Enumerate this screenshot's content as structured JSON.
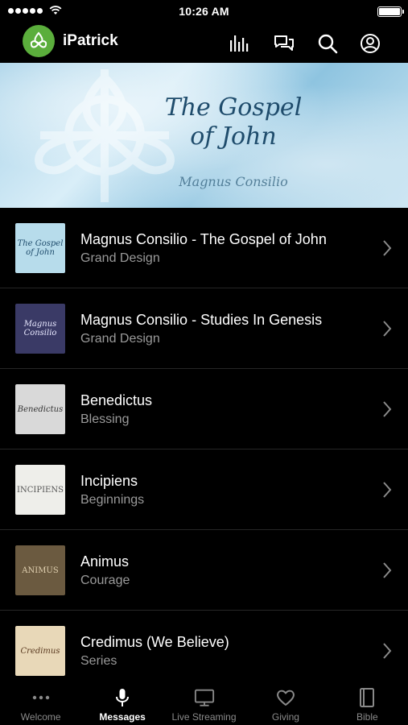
{
  "status_bar": {
    "time": "10:26 AM",
    "battery_level": 1.0
  },
  "header": {
    "app_title": "iPatrick",
    "icons": [
      "audio-bars-icon",
      "chat-bubbles-icon",
      "search-icon",
      "profile-icon"
    ]
  },
  "banner": {
    "title_line1": "The Gospel",
    "title_line2": "of John",
    "subtitle": "Magnus Consilio"
  },
  "list": {
    "items": [
      {
        "title": "Magnus Consilio - The Gospel of John",
        "subtitle": "Grand Design",
        "thumb_text": "The Gospel of John",
        "thumb_color": "#b7dceb"
      },
      {
        "title": "Magnus Consilio - Studies In Genesis",
        "subtitle": "Grand Design",
        "thumb_text": "Magnus Consilio",
        "thumb_color": "#3a3a66"
      },
      {
        "title": "Benedictus",
        "subtitle": "Blessing",
        "thumb_text": "Benedictus",
        "thumb_color": "#d9d9d9"
      },
      {
        "title": "Incipiens",
        "subtitle": "Beginnings",
        "thumb_text": "INCIPIENS",
        "thumb_color": "#eeeeea"
      },
      {
        "title": "Animus",
        "subtitle": "Courage",
        "thumb_text": "ANIMUS",
        "thumb_color": "#6b5a40"
      },
      {
        "title": "Credimus (We Believe)",
        "subtitle": "Series",
        "thumb_text": "Credimus",
        "thumb_color": "#e8d8b8"
      }
    ]
  },
  "tab_bar": {
    "tabs": [
      {
        "label": "Welcome",
        "icon": "more-dots-icon",
        "active": false
      },
      {
        "label": "Messages",
        "icon": "microphone-icon",
        "active": true
      },
      {
        "label": "Live Streaming",
        "icon": "monitor-icon",
        "active": false
      },
      {
        "label": "Giving",
        "icon": "heart-icon",
        "active": false
      },
      {
        "label": "Bible",
        "icon": "book-icon",
        "active": false
      }
    ]
  },
  "colors": {
    "brand_green": "#5bae3c",
    "background": "#000000",
    "secondary_text": "#9a9a9a"
  }
}
